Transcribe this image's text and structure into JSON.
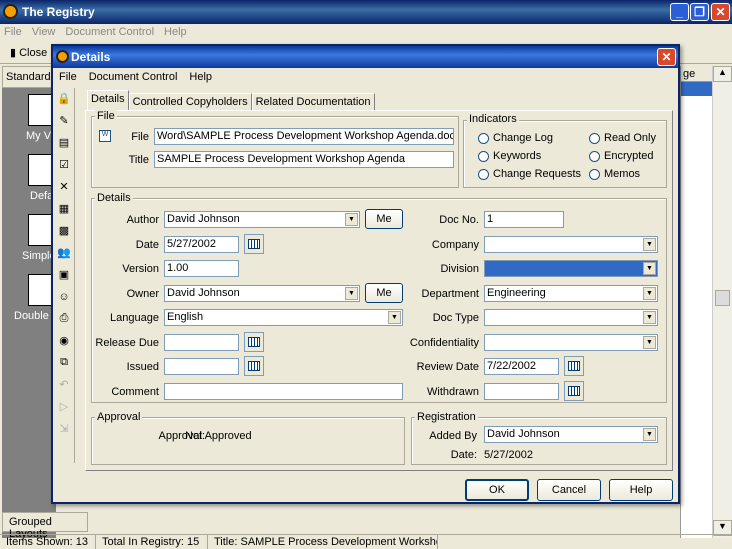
{
  "app": {
    "title": "The Registry",
    "menu": [
      "File",
      "View",
      "Document Control",
      "Help"
    ],
    "close_label": "Close",
    "standard_label": "Standard",
    "views": [
      "My Vi",
      "Defa",
      "Simple",
      "Double l"
    ],
    "grouped_layouts": "Grouped Layouts",
    "grid_header": "ge"
  },
  "status": {
    "shown": "Items Shown: 13",
    "total": "Total In Registry: 15",
    "title": "Title: SAMPLE Process Development Workshop Age"
  },
  "dialog": {
    "title": "Details",
    "menu": [
      "File",
      "Document Control",
      "Help"
    ],
    "tabs": [
      "Details",
      "Controlled Copyholders",
      "Related Documentation"
    ],
    "file_group": "File",
    "file_label": "File",
    "file_value": "Word\\SAMPLE Process Development Workshop Agenda.doc",
    "title_label": "Title",
    "title_value": "SAMPLE Process Development Workshop Agenda",
    "indicators_group": "Indicators",
    "indicators": [
      "Change Log",
      "Keywords",
      "Change Requests",
      "Read Only",
      "Encrypted",
      "Memos"
    ],
    "details_group": "Details",
    "author_label": "Author",
    "author_value": "David Johnson",
    "me_label": "Me",
    "date_label": "Date",
    "date_value": "5/27/2002",
    "version_label": "Version",
    "version_value": "1.00",
    "owner_label": "Owner",
    "owner_value": "David Johnson",
    "language_label": "Language",
    "language_value": "English",
    "release_due_label": "Release Due",
    "release_due_value": "",
    "issued_label": "Issued",
    "issued_value": "",
    "comment_label": "Comment",
    "comment_value": "",
    "docno_label": "Doc No.",
    "docno_value": "1",
    "company_label": "Company",
    "company_value": "",
    "division_label": "Division",
    "division_value": "",
    "department_label": "Department",
    "department_value": "Engineering",
    "doctype_label": "Doc Type",
    "doctype_value": "",
    "confidentiality_label": "Confidentiality",
    "confidentiality_value": "",
    "review_date_label": "Review Date",
    "review_date_value": "7/22/2002",
    "withdrawn_label": "Withdrawn",
    "withdrawn_value": "",
    "approval_group": "Approval",
    "approval_label": "Approval:",
    "approval_value": "Not Approved",
    "registration_group": "Registration",
    "added_by_label": "Added By",
    "added_by_value": "David Johnson",
    "reg_date_label": "Date:",
    "reg_date_value": "5/27/2002",
    "ok_label": "OK",
    "cancel_label": "Cancel",
    "help_label": "Help"
  }
}
